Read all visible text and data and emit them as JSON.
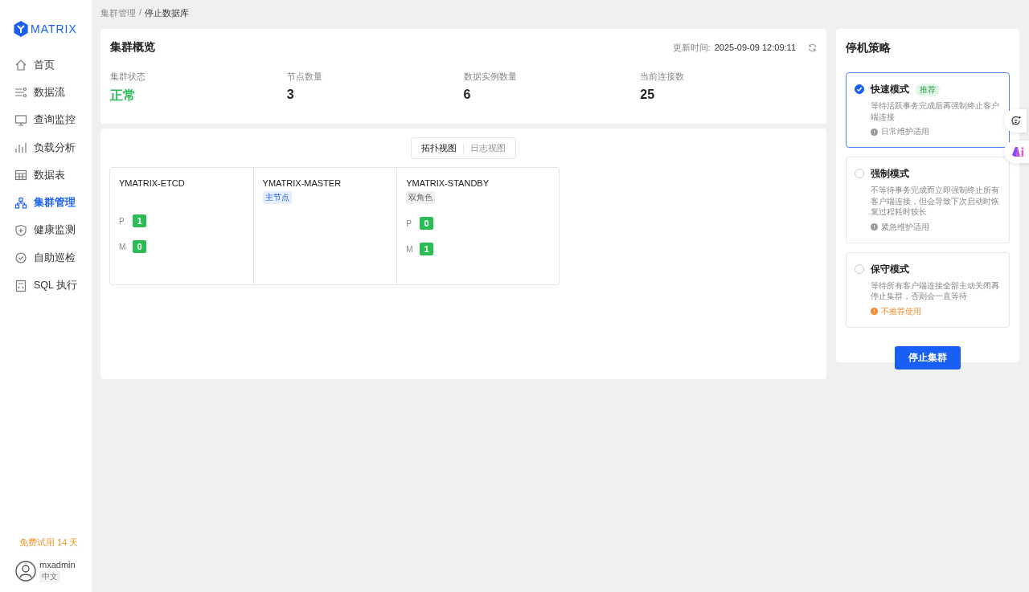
{
  "sidebar": {
    "logo_text": "MATRIX",
    "items": [
      {
        "label": "首页",
        "selected": false
      },
      {
        "label": "数据流",
        "selected": false
      },
      {
        "label": "查询监控",
        "selected": false
      },
      {
        "label": "负载分析",
        "selected": false
      },
      {
        "label": "数据表",
        "selected": false
      },
      {
        "label": "集群管理",
        "selected": true
      },
      {
        "label": "健康监测",
        "selected": false
      },
      {
        "label": "自助巡检",
        "selected": false
      },
      {
        "label": "SQL 执行",
        "selected": false
      }
    ],
    "trial": "免费试用 14 天",
    "user": {
      "name": "mxadmin",
      "language": "中文"
    }
  },
  "breadcrumb_separator": "/",
  "breadcrumb": [
    {
      "label": "集群管理",
      "current": false
    },
    {
      "label": "停止数据库",
      "current": true
    }
  ],
  "overview": {
    "title": "集群概览",
    "updated_label": "更新时间:",
    "updated_time": "2025-09-09 12:09:11",
    "stats": [
      {
        "label": "集群状态",
        "value": "正常",
        "kind": "status"
      },
      {
        "label": "节点数量",
        "value": "3",
        "kind": "number"
      },
      {
        "label": "数据实例数量",
        "value": "6",
        "kind": "number"
      },
      {
        "label": "当前连接数",
        "value": "25",
        "kind": "number"
      }
    ]
  },
  "view_tabs": [
    {
      "label": "拓扑视图",
      "selected": true
    },
    {
      "label": "日志视图",
      "selected": false
    }
  ],
  "nodes": [
    {
      "name": "YMATRIX-ETCD",
      "instances": [
        {
          "label": "P",
          "count": "1"
        },
        {
          "label": "M",
          "count": "0"
        }
      ]
    },
    {
      "name": "YMATRIX-MASTER",
      "tag": {
        "text": "主节点",
        "kind": "primary"
      }
    },
    {
      "name": "YMATRIX-STANDBY",
      "tag": {
        "text": "双角色",
        "kind": "neutral"
      },
      "instances": [
        {
          "label": "P",
          "count": "0"
        },
        {
          "label": "M",
          "count": "1"
        }
      ]
    }
  ],
  "strategy": {
    "title": "停机策略",
    "modes": [
      {
        "title": "快速模式",
        "badge": "推荐",
        "selected": true,
        "description": "等待活跃事务完成后再强制终止客户端连接",
        "note": {
          "text": "日常维护适用",
          "kind": "info"
        }
      },
      {
        "title": "强制模式",
        "selected": false,
        "description": "不等待事务完成而立即强制终止所有客户端连接，但会导致下次启动时恢复过程耗时较长",
        "note": {
          "text": "紧急维护适用",
          "kind": "info"
        }
      },
      {
        "title": "保守模式",
        "selected": false,
        "description": "等待所有客户端连接全部主动关闭再停止集群，否则会一直等待",
        "note": {
          "text": "不推荐使用",
          "kind": "warning"
        }
      }
    ],
    "button": "停止集群"
  }
}
